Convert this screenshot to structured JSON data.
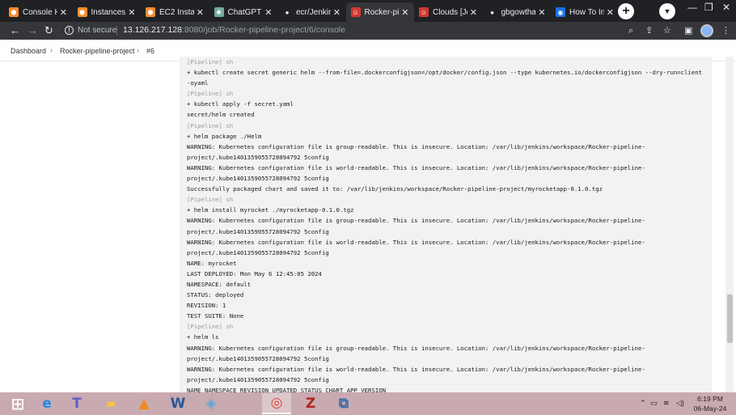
{
  "browser": {
    "tabs": [
      {
        "title": "Console Ho",
        "icon": "aws-icon",
        "color": "#f68d2e"
      },
      {
        "title": "Instances |",
        "icon": "aws-icon",
        "color": "#f68d2e"
      },
      {
        "title": "EC2 Instanc",
        "icon": "aws-icon",
        "color": "#f68d2e"
      },
      {
        "title": "ChatGPT",
        "icon": "chatgpt-icon",
        "color": "#74aa9c"
      },
      {
        "title": "ecr/Jenkins",
        "icon": "github-icon",
        "color": "#ffffff"
      },
      {
        "title": "Rocker-pipe",
        "icon": "jenkins-icon",
        "color": "#d33833"
      },
      {
        "title": "Clouds [Jen",
        "icon": "jenkins-icon",
        "color": "#d33833"
      },
      {
        "title": "gbgowthan",
        "icon": "github-icon",
        "color": "#ffffff"
      },
      {
        "title": "How To Ins",
        "icon": "globe-icon",
        "color": "#1a73e8"
      }
    ],
    "active_tab_index": 5,
    "address": {
      "security": "Not secure",
      "host": "13.126.217.128",
      "path": ":8080/job/Rocker-pipeline-project/6/console"
    }
  },
  "breadcrumb": {
    "items": [
      "Dashboard",
      "Rocker-pipeline-project",
      "#6"
    ],
    "separator": "›"
  },
  "console": {
    "lines": [
      {
        "text": "[Pipeline] sh",
        "dim": true
      },
      {
        "text": "+ kubectl create secret generic helm --from-file=.dockerconfigjson=/opt/docker/config.json --type kubernetes.io/dockerconfigjson --dry-run=client",
        "dim": false
      },
      {
        "text": "-oyaml",
        "dim": false
      },
      {
        "text": "[Pipeline] sh",
        "dim": true
      },
      {
        "text": "+ kubectl apply -f secret.yaml",
        "dim": false
      },
      {
        "text": "secret/helm created",
        "dim": false
      },
      {
        "text": "[Pipeline] sh",
        "dim": true
      },
      {
        "text": "+ helm package ./Helm",
        "dim": false
      },
      {
        "text": "WARNING: Kubernetes configuration file is group-readable. This is insecure. Location: /var/lib/jenkins/workspace/Rocker-pipeline-",
        "dim": false
      },
      {
        "text": "project/.kube1401359055728094792 5config",
        "dim": false
      },
      {
        "text": "WARNING: Kubernetes configuration file is world-readable. This is insecure. Location: /var/lib/jenkins/workspace/Rocker-pipeline-",
        "dim": false
      },
      {
        "text": "project/.kube1401359055728094792 5config",
        "dim": false
      },
      {
        "text": "Successfully packaged chart and saved it to: /var/lib/jenkins/workspace/Rocker-pipeline-project/myrocketapp-0.1.0.tgz",
        "dim": false
      },
      {
        "text": "[Pipeline] sh",
        "dim": true
      },
      {
        "text": "+ helm install myrocket ./myrocketapp-0.1.0.tgz",
        "dim": false
      },
      {
        "text": "WARNING: Kubernetes configuration file is group-readable. This is insecure. Location: /var/lib/jenkins/workspace/Rocker-pipeline-",
        "dim": false
      },
      {
        "text": "project/.kube1401359055728094792 5config",
        "dim": false
      },
      {
        "text": "WARNING: Kubernetes configuration file is world-readable. This is insecure. Location: /var/lib/jenkins/workspace/Rocker-pipeline-",
        "dim": false
      },
      {
        "text": "project/.kube1401359055728094792 5config",
        "dim": false
      },
      {
        "text": "NAME: myrocket",
        "dim": false
      },
      {
        "text": "LAST DEPLOYED: Mon May  6 12:45:05 2024",
        "dim": false
      },
      {
        "text": "NAMESPACE: default",
        "dim": false
      },
      {
        "text": "STATUS: deployed",
        "dim": false
      },
      {
        "text": "REVISION: 1",
        "dim": false
      },
      {
        "text": "TEST SUITE: None",
        "dim": false
      },
      {
        "text": "[Pipeline] sh",
        "dim": true
      },
      {
        "text": "+ helm ls",
        "dim": false
      },
      {
        "text": "WARNING: Kubernetes configuration file is group-readable. This is insecure. Location: /var/lib/jenkins/workspace/Rocker-pipeline-",
        "dim": false
      },
      {
        "text": "project/.kube1401359055728094792 5config",
        "dim": false
      },
      {
        "text": "WARNING: Kubernetes configuration file is world-readable. This is insecure. Location: /var/lib/jenkins/workspace/Rocker-pipeline-",
        "dim": false
      },
      {
        "text": "project/.kube1401359055728094792 5config",
        "dim": false
      },
      {
        "text": "NAME          NAMESPACE      REVISION        UPDATED                                   STATUS          CHART                 APP VERSION",
        "dim": false
      }
    ]
  },
  "taskbar": {
    "apps": [
      {
        "name": "start-button",
        "icon": "windows-icon",
        "color": "#ffffff"
      },
      {
        "name": "internet-explorer",
        "icon": "ie-icon",
        "color": "#1e88e5"
      },
      {
        "name": "teams",
        "icon": "teams-icon",
        "color": "#5b5fc7"
      },
      {
        "name": "file-explorer",
        "icon": "folder-icon",
        "color": "#f3c24f"
      },
      {
        "name": "vlc",
        "icon": "vlc-icon",
        "color": "#f08a1c"
      },
      {
        "name": "word",
        "icon": "word-icon",
        "color": "#2b579a"
      },
      {
        "name": "paint",
        "icon": "paint-icon",
        "color": "#5da8d8"
      },
      {
        "name": "chrome",
        "icon": "chrome-icon",
        "color": "#db4437"
      },
      {
        "name": "filezilla",
        "icon": "filezilla-icon",
        "color": "#b22222"
      },
      {
        "name": "network-app",
        "icon": "network-icon",
        "color": "#3a6ea5"
      }
    ],
    "clock": {
      "time": "6:19 PM",
      "date": "06-May-24"
    }
  },
  "colors": {
    "tabstrip": "#202124",
    "toolbar": "#35363a",
    "console_bg": "#f2f2f2",
    "taskbar": "#c9aab0"
  }
}
